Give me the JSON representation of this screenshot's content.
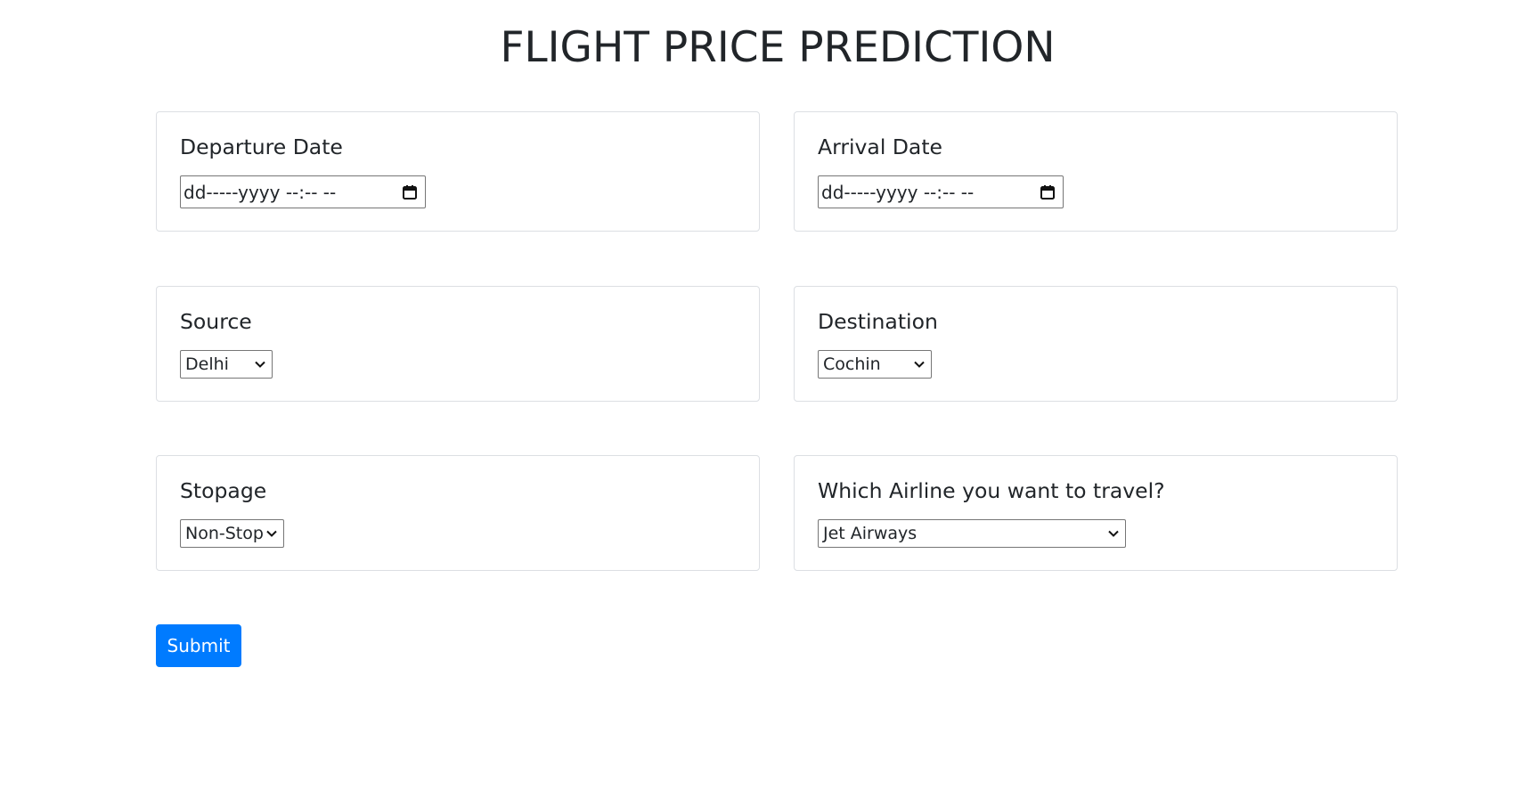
{
  "page": {
    "title": "FLIGHT PRICE PREDICTION"
  },
  "departure": {
    "label": "Departure Date",
    "placeholder": "dd-----yyyy --:-- --"
  },
  "arrival": {
    "label": "Arrival Date",
    "placeholder": "dd-----yyyy --:-- --"
  },
  "source": {
    "label": "Source",
    "selected": "Delhi"
  },
  "destination": {
    "label": "Destination",
    "selected": "Cochin"
  },
  "stopage": {
    "label": "Stopage",
    "selected": "Non-Stop"
  },
  "airline": {
    "label": "Which Airline you want to travel?",
    "selected": "Jet Airways"
  },
  "form": {
    "submit_label": "Submit"
  },
  "colors": {
    "primary": "#007bff",
    "text": "#212529",
    "card_border": "#dcdfe3"
  },
  "icons": {
    "calendar": "calendar-icon",
    "dropdown": "chevron-down-icon"
  }
}
